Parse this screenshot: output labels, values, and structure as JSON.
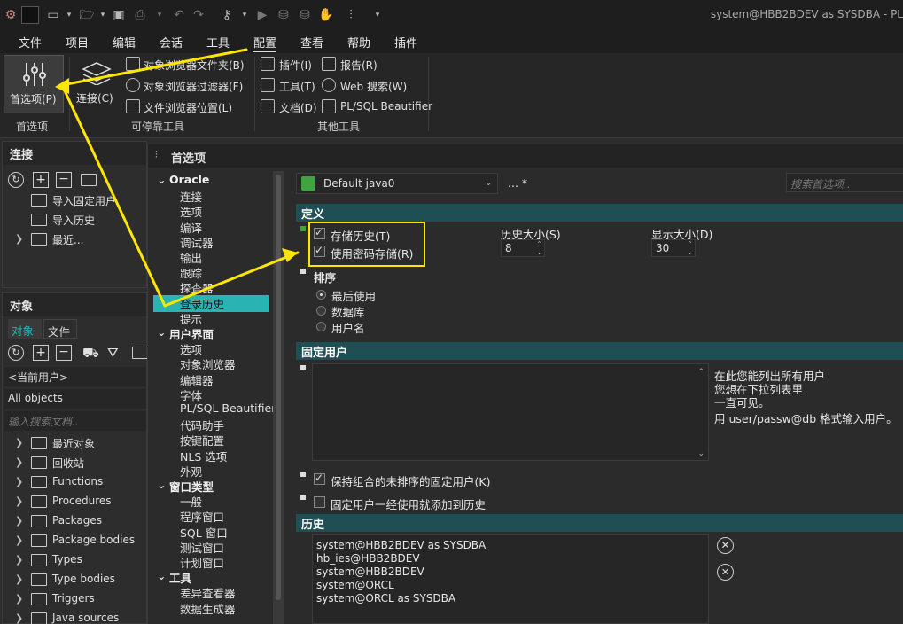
{
  "window": {
    "title": "system@HBB2BDEV as SYSDBA - PL"
  },
  "menubar": [
    "文件",
    "项目",
    "编辑",
    "会话",
    "工具",
    "配置",
    "查看",
    "帮助",
    "插件"
  ],
  "ribbon": {
    "prefs_button": "首选项(P)",
    "connect_button": "连接(C)",
    "dockable_items": [
      "对象浏览器文件夹(B)",
      "对象浏览器过滤器(F)",
      "文件浏览器位置(L)"
    ],
    "other_col1": [
      "插件(I)",
      "工具(T)",
      "文档(D)"
    ],
    "other_col2": [
      "报告(R)",
      "Web 搜索(W)",
      "PL/SQL Beautifier"
    ],
    "group_prefs": "首选项",
    "group_dockable": "可停靠工具",
    "group_other": "其他工具"
  },
  "connection_panel": {
    "title": "连接",
    "items": [
      "导入固定用户",
      "导入历史",
      "最近..."
    ]
  },
  "object_panel": {
    "title": "对象",
    "tabs": [
      "对象",
      "文件"
    ],
    "user_select": "<当前用户>",
    "filter_select": "All objects",
    "search_placeholder": "输入搜索文档..",
    "items": [
      "最近对象",
      "回收站",
      "Functions",
      "Procedures",
      "Packages",
      "Package bodies",
      "Types",
      "Type bodies",
      "Triggers",
      "Java sources"
    ]
  },
  "dialog": {
    "title": "首选项",
    "profile": "Default java0",
    "profile_more": "... *",
    "search_placeholder": "搜索首选项..",
    "nav": {
      "oracle": "Oracle",
      "oracle_items": [
        "连接",
        "选项",
        "编译",
        "调试器",
        "输出",
        "跟踪",
        "探查器",
        "登录历史",
        "提示"
      ],
      "ui": "用户界面",
      "ui_items": [
        "选项",
        "对象浏览器",
        "编辑器",
        "字体",
        "PL/SQL Beautifier",
        "代码助手",
        "按键配置",
        "NLS 选项",
        "外观"
      ],
      "wintype": "窗口类型",
      "wintype_items": [
        "一般",
        "程序窗口",
        "SQL 窗口",
        "测试窗口",
        "计划窗口"
      ],
      "tools": "工具",
      "tools_items": [
        "差异查看器",
        "数据生成器"
      ]
    },
    "definition": {
      "header": "定义",
      "store_history": "存储历史(T)",
      "store_with_password": "使用密码存储(R)",
      "history_size_label": "历史大小(S)",
      "history_size": "8",
      "display_size_label": "显示大小(D)",
      "display_size": "30"
    },
    "sort": {
      "header": "排序",
      "options": [
        "最后使用",
        "数据库",
        "用户名"
      ]
    },
    "fixed_users": {
      "header": "固定用户",
      "help_lines": [
        "在此您能列出所有用户",
        "您想在下拉列表里",
        "一直可见。",
        "用 user/passw@db 格式输入用户。"
      ],
      "keep_unsorted": "保持组合的未排序的固定用户(K)",
      "add_to_history": "固定用户一经使用就添加到历史"
    },
    "history": {
      "header": "历史",
      "entries": [
        "system@HBB2BDEV as SYSDBA",
        "hb_ies@HBB2BDEV",
        "system@HBB2BDEV",
        "system@ORCL",
        "system@ORCL as SYSDBA"
      ]
    }
  },
  "colors": {
    "accent": "#2ab3b3",
    "section": "#1f4f55",
    "highlight": "#ffe600"
  }
}
